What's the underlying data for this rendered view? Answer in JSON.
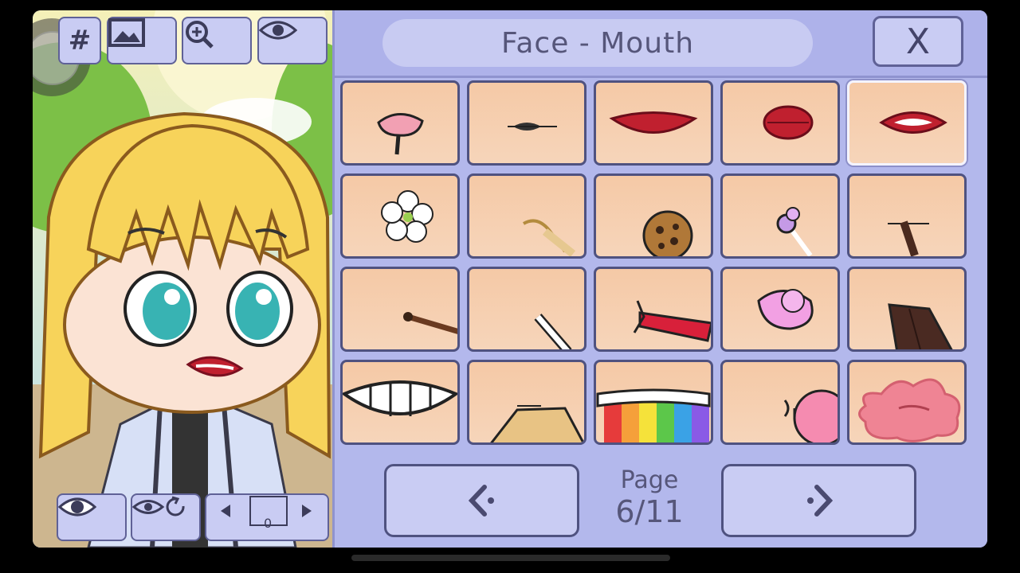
{
  "panel": {
    "title": "Face - Mouth",
    "close_label": "X",
    "page_label": "Page",
    "page_value": "6/11",
    "prev_icon": "chevron-left-dot-icon",
    "next_icon": "chevron-right-dot-icon"
  },
  "toolbar": {
    "hash_label": "#",
    "icons": [
      "image-icon",
      "zoom-in-icon",
      "eye-icon"
    ]
  },
  "bottom_bar": {
    "icons": [
      "eye-icon",
      "eye-reset-icon",
      "layer-arrows-icon"
    ],
    "layer_count": "0"
  },
  "mouth_items": [
    "drool-mouth",
    "small-dark-lips",
    "wide-red-lips",
    "pouty-red-lips",
    "open-red-lips",
    "flower-in-mouth",
    "wheat-stalk",
    "cookie",
    "lollipop",
    "chocolate-stick",
    "stick",
    "white-stick",
    "candy-wrapper",
    "pink-gum-piece",
    "chocolate-bar",
    "wide-grin",
    "toast-bite",
    "rainbow-mouth",
    "bubble-gum",
    "pink-splat"
  ],
  "selected_index": 4,
  "colors": {
    "panel": "#b3b8ec",
    "button": "#c9ccf3",
    "border": "#4f5280",
    "cell": "#f5c9a6",
    "text": "#56567a"
  }
}
